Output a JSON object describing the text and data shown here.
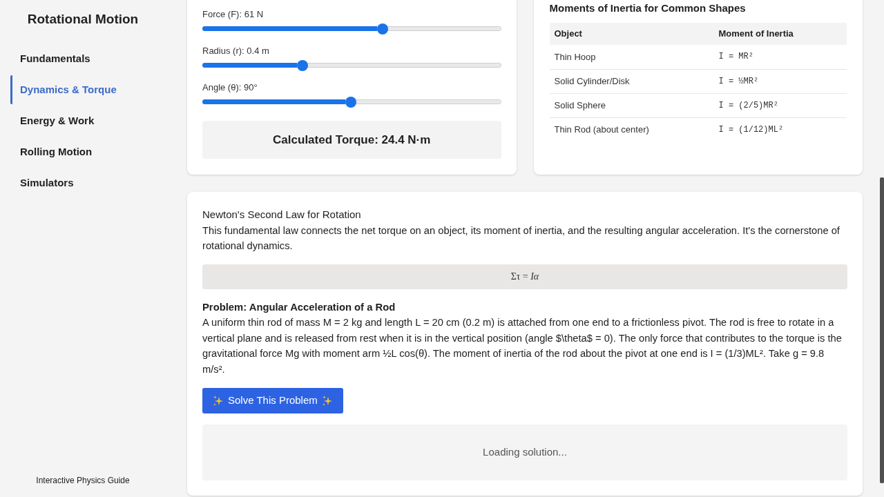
{
  "sidebar": {
    "title": "Rotational Motion",
    "items": [
      {
        "label": "Fundamentals",
        "selected": false
      },
      {
        "label": "Dynamics & Torque",
        "selected": true
      },
      {
        "label": "Energy & Work",
        "selected": false
      },
      {
        "label": "Rolling Motion",
        "selected": false
      },
      {
        "label": "Simulators",
        "selected": false
      }
    ],
    "footer": "Interactive Physics Guide"
  },
  "torque_calculator": {
    "sliders": [
      {
        "label": "Force (F): 61 N",
        "level": 0.61
      },
      {
        "label": "Radius (r): 0.4 m",
        "level": 0.33
      },
      {
        "label": "Angle (θ): 90°",
        "level": 0.5
      }
    ],
    "result": "Calculated Torque: 24.4 N·m"
  },
  "inertia_table": {
    "title": "Moments of Inertia for Common Shapes",
    "columns": [
      "Object",
      "Moment of Inertia"
    ],
    "rows": [
      [
        "Thin Hoop",
        "I = MR²"
      ],
      [
        "Solid Cylinder/Disk",
        "I = ½MR²"
      ],
      [
        "Solid Sphere",
        "I = (2/5)MR²"
      ],
      [
        "Thin Rod (about center)",
        "I = (1/12)ML²"
      ]
    ]
  },
  "newtons_second_law": {
    "title": "Newton's Second Law for Rotation",
    "description": "This fundamental law connects the net torque on an object, its moment of inertia, and the resulting angular acceleration. It's the cornerstone of rotational dynamics.",
    "formula": "Στ = *Iα*",
    "problem": {
      "title": "Problem: Angular Acceleration of a Rod",
      "text": "A uniform thin rod of mass M = 2 kg and length L = 20 cm (0.2 m) is attached from one end to a frictionless pivot. The rod is free to rotate in a vertical plane and is released from rest when it is in the vertical position (angle $\\theta$ = 0). The only force that contributes to the torque is the gravitational force Mg with moment arm ½L cos(θ). The moment of inertia of the rod about the pivot at one end is I = (1/3)ML². Take g = 9.8 m/s².",
      "button": "Solve This Problem",
      "solution": "Loading solution..."
    }
  }
}
